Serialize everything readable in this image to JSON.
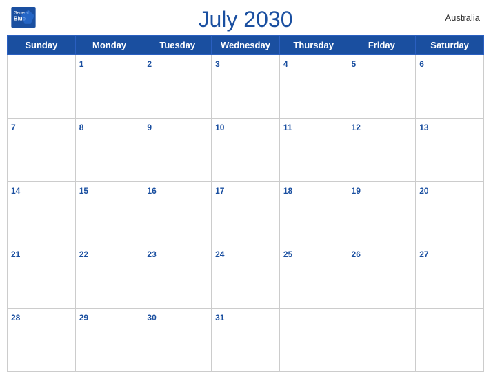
{
  "header": {
    "title": "July 2030",
    "country": "Australia",
    "logo": {
      "general": "General",
      "blue": "Blue"
    }
  },
  "weekdays": [
    "Sunday",
    "Monday",
    "Tuesday",
    "Wednesday",
    "Thursday",
    "Friday",
    "Saturday"
  ],
  "weeks": [
    [
      null,
      1,
      2,
      3,
      4,
      5,
      6
    ],
    [
      7,
      8,
      9,
      10,
      11,
      12,
      13
    ],
    [
      14,
      15,
      16,
      17,
      18,
      19,
      20
    ],
    [
      21,
      22,
      23,
      24,
      25,
      26,
      27
    ],
    [
      28,
      29,
      30,
      31,
      null,
      null,
      null
    ]
  ],
  "colors": {
    "primary": "#1a4fa0",
    "header_bg": "#1a4fa0",
    "cell_date_color": "#1a4fa0",
    "border": "#ccc"
  }
}
